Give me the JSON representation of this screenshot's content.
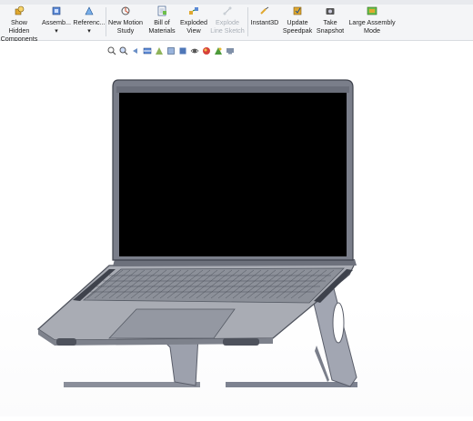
{
  "ribbon": {
    "buttons": [
      {
        "label": "Show Hidden\nComponents",
        "icon": "show-hidden-components-icon",
        "disabled": false
      },
      {
        "label": "Assemb...",
        "icon": "assembly-icon",
        "disabled": false,
        "dropdown": "▾"
      },
      {
        "label": "Referenc...",
        "icon": "reference-icon",
        "disabled": false,
        "dropdown": "▾"
      },
      {
        "label": "New Motion\nStudy",
        "icon": "motion-study-icon",
        "disabled": false
      },
      {
        "label": "Bill of\nMaterials",
        "icon": "bill-of-materials-icon",
        "disabled": false
      },
      {
        "label": "Exploded\nView",
        "icon": "exploded-view-icon",
        "disabled": false
      },
      {
        "label": "Explode\nLine Sketch",
        "icon": "explode-line-sketch-icon",
        "disabled": true
      },
      {
        "label": "Instant3D",
        "icon": "instant3d-icon",
        "disabled": false
      },
      {
        "label": "Update\nSpeedpak",
        "icon": "speedpak-icon",
        "disabled": false
      },
      {
        "label": "Take\nSnapshot",
        "icon": "snapshot-icon",
        "disabled": false
      },
      {
        "label": "Large Assembly\nMode",
        "icon": "large-assembly-icon",
        "disabled": false
      }
    ]
  },
  "hud": {
    "icons": [
      "zoom-fit-icon",
      "zoom-area-icon",
      "previous-view-icon",
      "section-view-icon",
      "dynamic-annotation-icon",
      "view-orientation-icon",
      "display-style-icon",
      "hide-show-icon",
      "edit-appearance-icon",
      "apply-scene-icon",
      "view-settings-icon"
    ]
  },
  "model": {
    "name": "laptop-on-stand"
  },
  "colors": {
    "accent": "#2f6fbf",
    "screen": "#000000",
    "laptop_body": "#a9acb4",
    "stand": "#8a8e9a"
  }
}
